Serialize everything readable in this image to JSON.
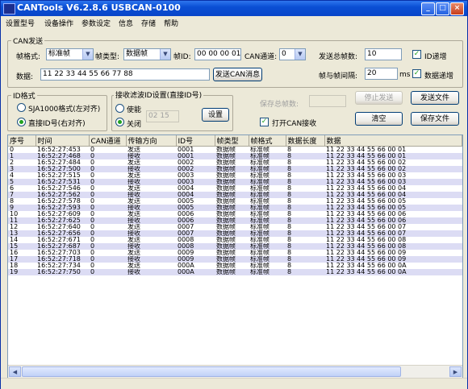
{
  "window": {
    "title": "CANTools V6.2.8.6  USBCAN-0100",
    "minimize": "_",
    "maximize": "□",
    "close": "×"
  },
  "menu": [
    "设置型号",
    "设备操作",
    "参数设定",
    "信息",
    "存储",
    "帮助"
  ],
  "can_send": {
    "group_label": "CAN发送",
    "frame_format_label": "帧格式:",
    "frame_format_value": "标准帧",
    "frame_type_label": "帧类型:",
    "frame_type_value": "数据帧",
    "frame_id_label": "帧ID:",
    "frame_id_value": "00 00 00 01",
    "can_channel_label": "CAN通道:",
    "can_channel_value": "0",
    "send_total_label": "发送总帧数:",
    "send_total_value": "10",
    "id_increment_label": "ID递增",
    "data_label": "数据:",
    "data_value": "11 22 33 44 55 66 77 88",
    "send_button": "发送CAN消息",
    "interval_label": "帧与帧间隔:",
    "interval_value": "20",
    "interval_unit": "ms",
    "data_increment_label": "数据递增"
  },
  "id_format": {
    "group_label": "ID格式",
    "option_sja": "SJA1000格式(左对齐)",
    "option_direct": "直接ID号(右对齐)"
  },
  "filter": {
    "group_label": "接收滤波ID设置(直接ID号)",
    "enable_label": "使能",
    "disable_label": "关闭",
    "filter_id_value": "02 15",
    "set_button": "设置"
  },
  "controls": {
    "save_total_label": "保存总帧数:",
    "stop_send_button": "停止发送",
    "send_file_button": "发送文件",
    "open_can_receive_label": "打开CAN接收",
    "clear_button": "清空",
    "save_file_button": "保存文件"
  },
  "table": {
    "columns": [
      "序号",
      "时间",
      "CAN通道",
      "传输方向",
      "ID号",
      "帧类型",
      "帧格式",
      "数据长度",
      "数据"
    ],
    "rows": [
      [
        "0",
        "16:52:27:453",
        "0",
        "发送",
        "0001",
        "数据帧",
        "标准帧",
        "8",
        "11 22 33 44 55 66 00 01"
      ],
      [
        "1",
        "16:52:27:468",
        "0",
        "接收",
        "0001",
        "数据帧",
        "标准帧",
        "8",
        "11 22 33 44 55 66 00 01"
      ],
      [
        "2",
        "16:52:27:484",
        "0",
        "发送",
        "0002",
        "数据帧",
        "标准帧",
        "8",
        "11 22 33 44 55 66 00 02"
      ],
      [
        "3",
        "16:52:27:500",
        "0",
        "接收",
        "0002",
        "数据帧",
        "标准帧",
        "8",
        "11 22 33 44 55 66 00 02"
      ],
      [
        "4",
        "16:52:27:515",
        "0",
        "发送",
        "0003",
        "数据帧",
        "标准帧",
        "8",
        "11 22 33 44 55 66 00 03"
      ],
      [
        "5",
        "16:52:27:531",
        "0",
        "接收",
        "0003",
        "数据帧",
        "标准帧",
        "8",
        "11 22 33 44 55 66 00 03"
      ],
      [
        "6",
        "16:52:27:546",
        "0",
        "发送",
        "0004",
        "数据帧",
        "标准帧",
        "8",
        "11 22 33 44 55 66 00 04"
      ],
      [
        "7",
        "16:52:27:562",
        "0",
        "接收",
        "0004",
        "数据帧",
        "标准帧",
        "8",
        "11 22 33 44 55 66 00 04"
      ],
      [
        "8",
        "16:52:27:578",
        "0",
        "发送",
        "0005",
        "数据帧",
        "标准帧",
        "8",
        "11 22 33 44 55 66 00 05"
      ],
      [
        "9",
        "16:52:27:593",
        "0",
        "接收",
        "0005",
        "数据帧",
        "标准帧",
        "8",
        "11 22 33 44 55 66 00 05"
      ],
      [
        "10",
        "16:52:27:609",
        "0",
        "发送",
        "0006",
        "数据帧",
        "标准帧",
        "8",
        "11 22 33 44 55 66 00 06"
      ],
      [
        "11",
        "16:52:27:625",
        "0",
        "接收",
        "0006",
        "数据帧",
        "标准帧",
        "8",
        "11 22 33 44 55 66 00 06"
      ],
      [
        "12",
        "16:52:27:640",
        "0",
        "发送",
        "0007",
        "数据帧",
        "标准帧",
        "8",
        "11 22 33 44 55 66 00 07"
      ],
      [
        "13",
        "16:52:27:656",
        "0",
        "接收",
        "0007",
        "数据帧",
        "标准帧",
        "8",
        "11 22 33 44 55 66 00 07"
      ],
      [
        "14",
        "16:52:27:671",
        "0",
        "发送",
        "0008",
        "数据帧",
        "标准帧",
        "8",
        "11 22 33 44 55 66 00 08"
      ],
      [
        "15",
        "16:52:27:687",
        "0",
        "接收",
        "0008",
        "数据帧",
        "标准帧",
        "8",
        "11 22 33 44 55 66 00 08"
      ],
      [
        "16",
        "16:52:27:703",
        "0",
        "发送",
        "0009",
        "数据帧",
        "标准帧",
        "8",
        "11 22 33 44 55 66 00 09"
      ],
      [
        "17",
        "16:52:27:718",
        "0",
        "接收",
        "0009",
        "数据帧",
        "标准帧",
        "8",
        "11 22 33 44 55 66 00 09"
      ],
      [
        "18",
        "16:52:27:734",
        "0",
        "发送",
        "000A",
        "数据帧",
        "标准帧",
        "8",
        "11 22 33 44 55 66 00 0A"
      ],
      [
        "19",
        "16:52:27:750",
        "0",
        "接收",
        "000A",
        "数据帧",
        "标准帧",
        "8",
        "11 22 33 44 55 66 00 0A"
      ]
    ]
  },
  "colors": {
    "titlebar": "#0a4fd4",
    "window_bg": "#ece9d8",
    "row_alt": "#dcdcf4",
    "check_mark": "#21a121"
  }
}
